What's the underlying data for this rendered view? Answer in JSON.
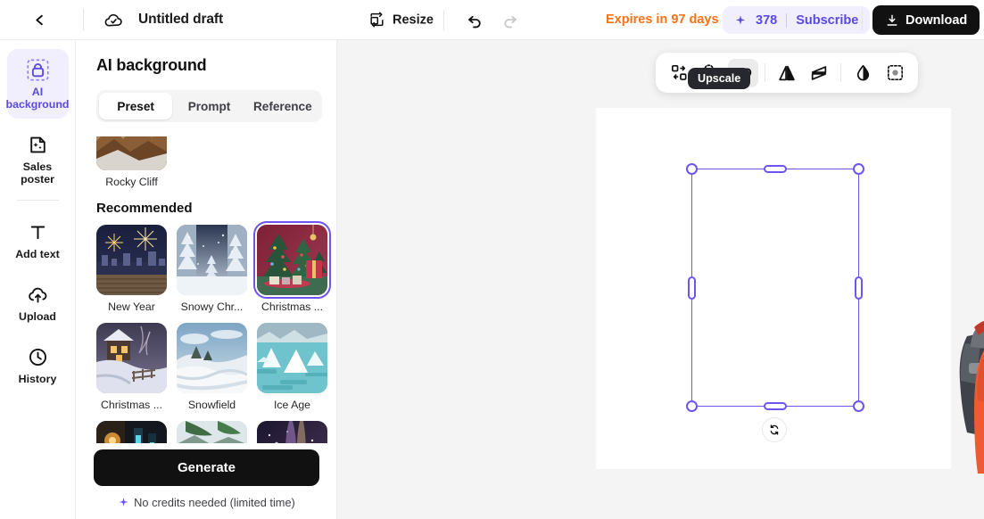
{
  "topbar": {
    "back_icon": "chevron-left-icon",
    "cloud_icon": "cloud-saved-icon",
    "doc_title": "Untitled draft",
    "resize_label": "Resize",
    "resize_icon": "resize-icon",
    "undo_icon": "undo-icon",
    "redo_icon": "redo-icon",
    "expires_text": "Expires in 97 days",
    "credits_icon": "sparkle-icon",
    "credits_value": "378",
    "subscribe_label": "Subscribe",
    "download_icon": "download-icon",
    "download_label": "Download",
    "accent_orange": "#f97316",
    "accent_purple": "#5b4ae0",
    "credits_pill_bg": "#f1eefe"
  },
  "rail": {
    "items": [
      {
        "label": "AI background",
        "icon": "ai-background-icon",
        "active": true
      },
      {
        "label": "Sales poster",
        "icon": "sales-poster-icon",
        "active": false
      },
      {
        "label": "Add text",
        "icon": "add-text-icon",
        "active": false
      },
      {
        "label": "Upload",
        "icon": "upload-cloud-icon",
        "active": false
      },
      {
        "label": "History",
        "icon": "history-clock-icon",
        "active": false
      }
    ]
  },
  "panel": {
    "title": "AI background",
    "tabs": [
      {
        "label": "Preset",
        "active": true
      },
      {
        "label": "Prompt",
        "active": false
      },
      {
        "label": "Reference",
        "active": false
      }
    ],
    "partial_top": [
      {
        "label": "Rocky Cliff",
        "selected": false
      }
    ],
    "section_title": "Recommended",
    "presets": [
      {
        "label": "New Year",
        "selected": false
      },
      {
        "label": "Snowy Chr...",
        "selected": false
      },
      {
        "label": "Christmas ...",
        "selected": true
      },
      {
        "label": "Christmas ...",
        "selected": false
      },
      {
        "label": "Snowfield",
        "selected": false
      },
      {
        "label": "Ice Age",
        "selected": false
      }
    ],
    "partial_bottom": [
      {
        "label": "",
        "selected": false
      },
      {
        "label": "",
        "selected": false
      },
      {
        "label": "",
        "selected": false
      }
    ],
    "generate_label": "Generate",
    "credits_note": "No credits needed (limited time)",
    "credits_note_icon": "sparkle-icon",
    "selected_outline": "#6d53f0"
  },
  "canvas": {
    "tooltip": "Upscale",
    "toolbar": [
      {
        "name": "replace-object-icon",
        "label": "",
        "active": false
      },
      {
        "name": "magic-wand-icon",
        "label": "",
        "active": false
      },
      {
        "name": "hd-upscale-icon",
        "label": "HD",
        "active": true
      },
      {
        "name": "flip-horizontal-icon",
        "label": "",
        "active": false
      },
      {
        "name": "flip-vertical-icon",
        "label": "",
        "active": false
      },
      {
        "name": "opacity-drop-icon",
        "label": "",
        "active": false
      },
      {
        "name": "remove-background-icon",
        "label": "",
        "active": false
      }
    ],
    "rotate_icon": "rotate-icon",
    "selection_color": "#6d53f0",
    "background": "#f4f4f4",
    "artboard_background": "#ffffff"
  }
}
